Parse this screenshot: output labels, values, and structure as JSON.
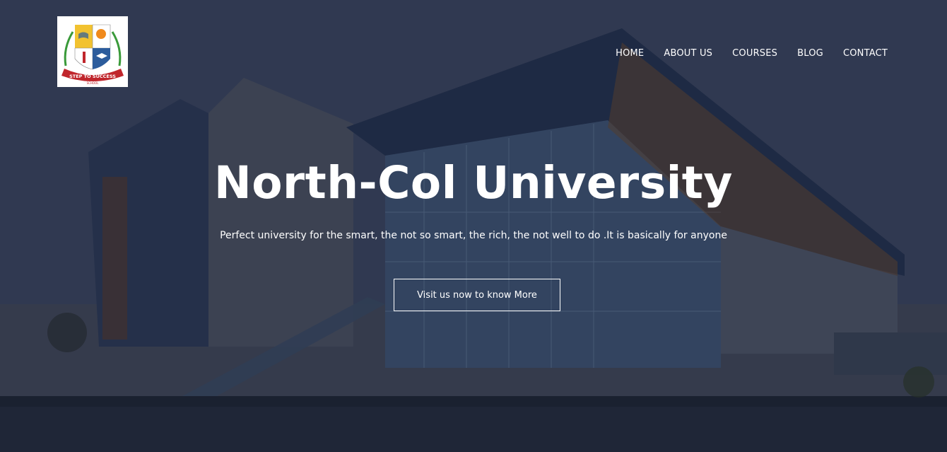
{
  "logo": {
    "icon": "school-crest-icon",
    "banner_text": "STEP TO SUCCESS",
    "sub_text": "SCHOOL"
  },
  "nav": {
    "items": [
      {
        "label": "HOME"
      },
      {
        "label": "ABOUT US"
      },
      {
        "label": "COURSES"
      },
      {
        "label": "BLOG"
      },
      {
        "label": "CONTACT"
      }
    ]
  },
  "hero": {
    "title": "North-Col University",
    "subtitle": "Perfect university for the smart, the not so smart, the rich, the not well to do .It is basically for anyone",
    "cta_label": "Visit us now to know More"
  },
  "colors": {
    "overlay": "#364259",
    "text": "#ffffff",
    "crest_red": "#c0262c",
    "crest_green": "#3a9a3a",
    "crest_blue": "#2c5c9c",
    "crest_yellow": "#f2c230"
  }
}
